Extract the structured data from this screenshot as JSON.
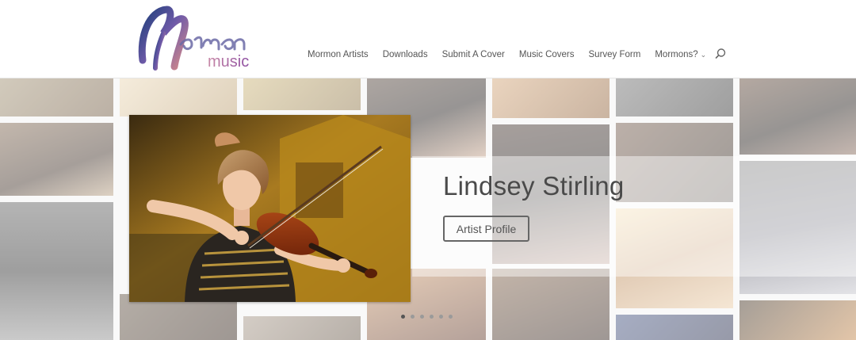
{
  "logo": {
    "word1": "Mormon",
    "word2": "music",
    "alt": "Mormon Music logo"
  },
  "nav": {
    "items": [
      {
        "label": "Mormon Artists"
      },
      {
        "label": "Downloads"
      },
      {
        "label": "Submit A Cover"
      },
      {
        "label": "Music Covers"
      },
      {
        "label": "Survey Form"
      },
      {
        "label": "Mormons?",
        "has_dropdown": true
      }
    ],
    "search_icon": "search-icon"
  },
  "slider": {
    "title": "Lindsey Stirling",
    "button_label": "Artist Profile",
    "slide_count": 6,
    "active_index": 0
  },
  "colors": {
    "nav_text": "#555555",
    "title_text": "#4a4a4a",
    "logo_blue": "#2a4f8f",
    "logo_purple": "#8e4fa2"
  }
}
